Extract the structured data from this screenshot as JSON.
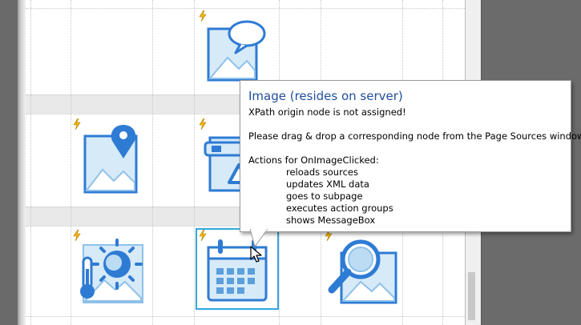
{
  "tooltip": {
    "title": "Image (resides on server)",
    "xpath_message": "XPath origin node is not assigned!",
    "instruction": "Please drag & drop a corresponding node from the Page Sources window.",
    "actions_header": "Actions for OnImageClicked:",
    "actions": [
      "reloads sources",
      "updates XML data",
      "goes to subpage",
      "executes action groups",
      "shows MessageBox"
    ]
  },
  "images": [
    {
      "icon": "image-speech-bubble-icon",
      "selected": false
    },
    {
      "icon": "image-map-pin-icon",
      "selected": false
    },
    {
      "icon": "image-car-warning-icon",
      "selected": false
    },
    {
      "icon": "image-thermometer-weather-icon",
      "selected": false
    },
    {
      "icon": "image-calendar-icon",
      "selected": true
    },
    {
      "icon": "image-magnifier-icon",
      "selected": false
    }
  ],
  "colors": {
    "icon_stroke": "#2e7bd4",
    "icon_fill": "#d6eaf8",
    "selection": "#33a6dc",
    "tooltip_title": "#1f4e9c",
    "bolt": "#e6a800"
  }
}
